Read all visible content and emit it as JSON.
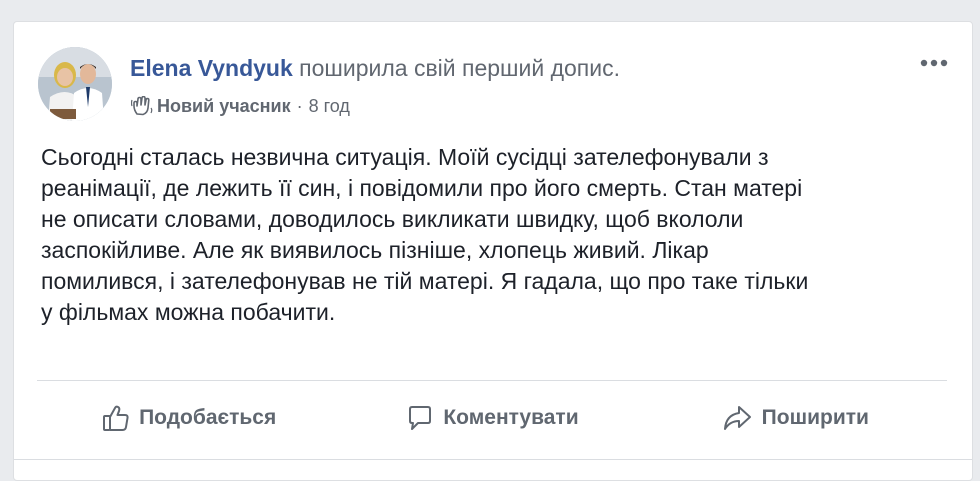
{
  "post": {
    "author": "Elena Vyndyuk",
    "action": "поширила свій перший допис.",
    "badge_label": "Новий учасник",
    "separator": "·",
    "time": "8 год",
    "text": "Сьогодні сталась незвична ситуація. Моїй сусідці зателефонували з\nреанімації, де лежить її син, і повідомили про його смерть. Стан матері\nне описати словами, доводилось викликати швидку, щоб вкололи\nзаспокійливе. Але як виявилось пізніше, хлопець живий. Лікар\nпомилився, і зателефонував не тій матері. Я гадала, що про таке тільки\nу фільмах можна побачити.",
    "icons": {
      "more": "more-horizontal-icon",
      "badge": "waving-hand-icon"
    }
  },
  "actions": {
    "like_label": "Подобається",
    "comment_label": "Коментувати",
    "share_label": "Поширити"
  },
  "colors": {
    "author": "#385898",
    "text": "#1d2129",
    "secondary": "#616770",
    "background": "#e9ebee"
  }
}
